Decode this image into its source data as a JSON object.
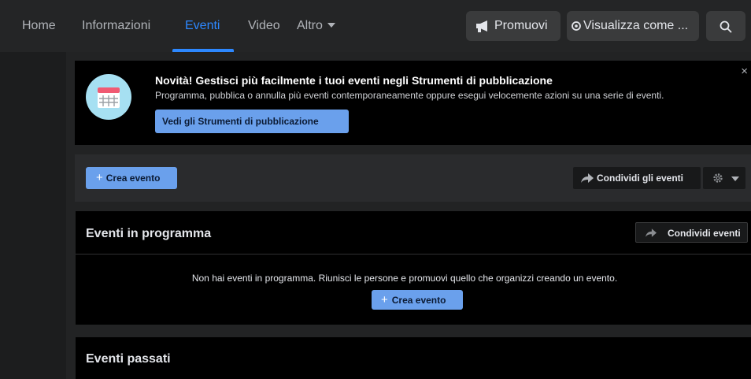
{
  "nav": {
    "tabs": [
      {
        "label": "Home"
      },
      {
        "label": "Informazioni"
      },
      {
        "label": "Eventi"
      },
      {
        "label": "Video"
      },
      {
        "label": "Altro"
      }
    ],
    "active_tab": "Eventi",
    "promote_label": "Promuovi",
    "view_as_label": "Visualizza come ...",
    "search_icon": "search-icon"
  },
  "banner": {
    "title": "Novità! Gestisci più facilmente i tuoi eventi negli Strumenti di pubblicazione",
    "description": "Programma, pubblica o annulla più eventi contemporaneamente oppure esegui velocemente azioni su una serie di eventi.",
    "button_label": "Vedi gli Strumenti di pubblicazione",
    "close_label": "×",
    "icon": "calendar-icon"
  },
  "toolbar": {
    "create_label": "Crea evento",
    "share_all_label": "Condividi gli eventi",
    "settings_icon": "gear-icon"
  },
  "upcoming": {
    "title": "Eventi in programma",
    "share_label": "Condividi eventi",
    "empty_message": "Non hai eventi in programma. Riunisci le persone e promuovi quello che organizzi creando un evento.",
    "create_label": "Crea evento"
  },
  "past": {
    "title": "Eventi passati"
  },
  "colors": {
    "accent": "#2d88ff",
    "button_blue": "#6aa0ec",
    "nav_bg": "#242526",
    "card_bg": "#000000"
  }
}
